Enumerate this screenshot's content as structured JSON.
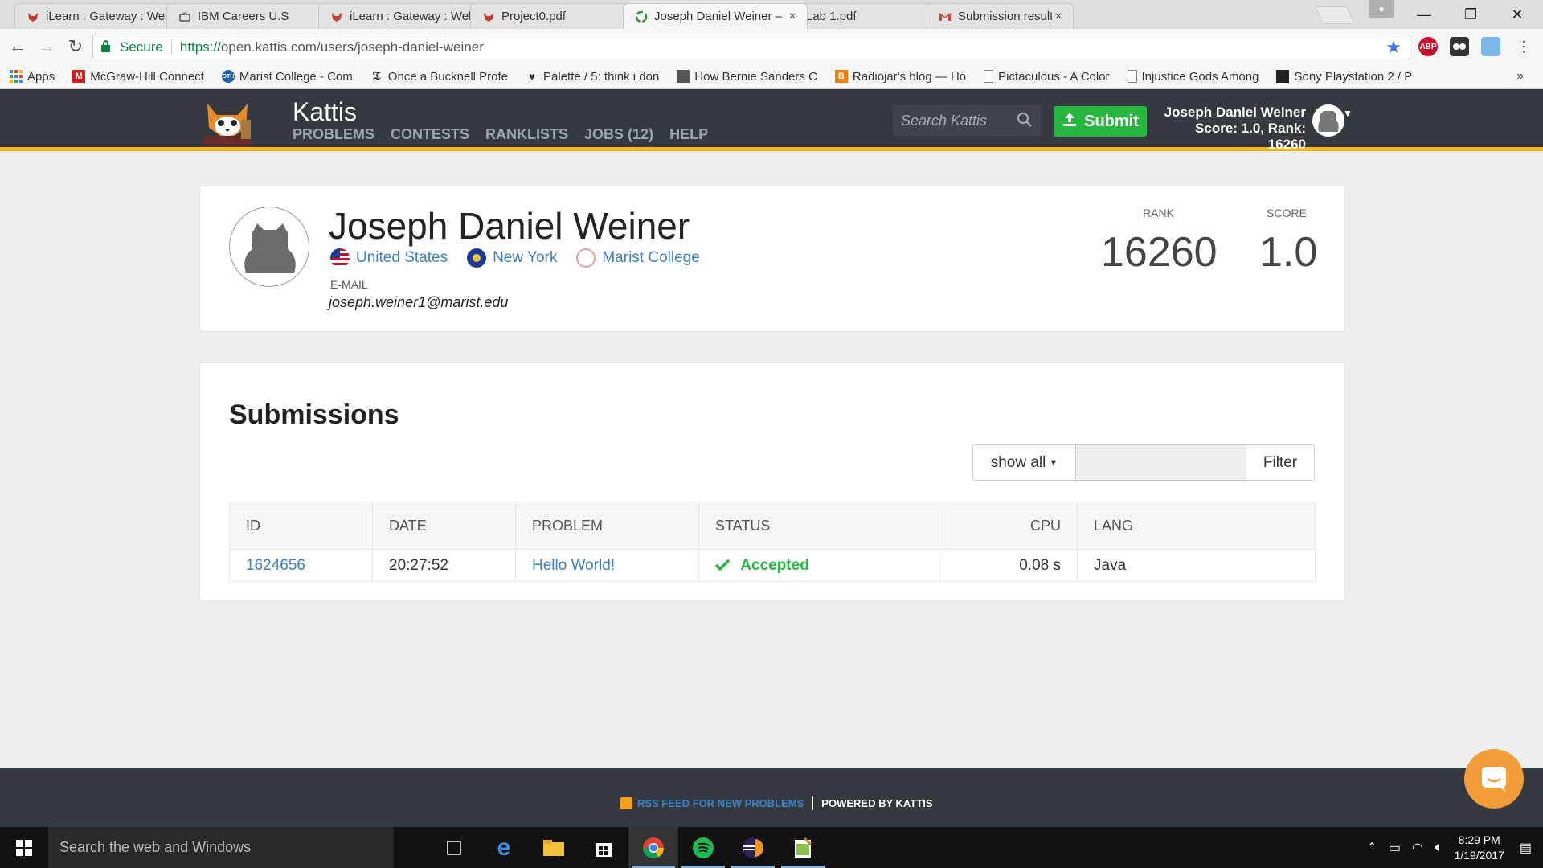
{
  "browser": {
    "tabs": [
      {
        "title": "iLearn : Gateway : Welc",
        "favicon": "fox-icon",
        "active": false
      },
      {
        "title": "IBM Careers U.S",
        "favicon": "briefcase-icon",
        "active": false
      },
      {
        "title": "iLearn : Gateway : Welc",
        "favicon": "fox-icon",
        "active": false
      },
      {
        "title": "Project0.pdf",
        "favicon": "fox-icon",
        "active": false
      },
      {
        "title": "Joseph Daniel Weiner –",
        "favicon": "kattis-icon",
        "active": true
      },
      {
        "title": "Lab 1.pdf",
        "favicon": "fox-icon",
        "active": false
      },
      {
        "title": "Submission result for: jo",
        "favicon": "gmail-icon",
        "active": false
      }
    ],
    "tab_close_glyph": "×",
    "window_controls": {
      "minimize": "—",
      "restore": "❐",
      "close": "✕"
    },
    "address": {
      "secure_label": "Secure",
      "url_scheme": "https://",
      "url_rest": "open.kattis.com/users/joseph-daniel-weiner"
    },
    "extensions": [
      {
        "name": "adblock-plus-icon",
        "label": "ABP",
        "color": "#c70d2c"
      },
      {
        "name": "ghostery-icon",
        "label": "",
        "color": "#333333"
      },
      {
        "name": "extension-icon",
        "label": "",
        "color": "#7ab6e8"
      }
    ],
    "bookmarks": [
      {
        "label": "Apps",
        "icon": "apps-grid-icon"
      },
      {
        "label": "McGraw-Hill Connect",
        "icon": "mcgraw-hill-icon"
      },
      {
        "label": "Marist College - Com",
        "icon": "marist-icon"
      },
      {
        "label": "Once a Bucknell Profe",
        "icon": "nyt-icon"
      },
      {
        "label": "Palette / 5: think i don",
        "icon": "heart-icon"
      },
      {
        "label": "How Bernie Sanders C",
        "icon": "image-icon"
      },
      {
        "label": "Radiojar's blog — Ho",
        "icon": "blogger-icon"
      },
      {
        "label": "Pictaculous - A Color",
        "icon": "page-icon"
      },
      {
        "label": "Injustice Gods Among",
        "icon": "page-icon"
      },
      {
        "label": "Sony Playstation 2 / P",
        "icon": "image-icon"
      }
    ],
    "bookmarks_more": "»"
  },
  "kattis": {
    "brand": "Kattis",
    "nav": [
      "PROBLEMS",
      "CONTESTS",
      "RANKLISTS",
      "JOBS (12)",
      "HELP"
    ],
    "search_placeholder": "Search Kattis",
    "submit_label": "Submit",
    "user_name": "Joseph Daniel Weiner",
    "user_stats": "Score: 1.0, Rank: 16260",
    "colors": {
      "accent": "#f6b21a",
      "header": "#343a40",
      "green": "#27b63f",
      "link": "#3d7fc1"
    }
  },
  "profile": {
    "name": "Joseph Daniel Weiner",
    "locations": [
      {
        "label": "United States",
        "icon": "us-flag-icon"
      },
      {
        "label": "New York",
        "icon": "new-york-flag-icon"
      },
      {
        "label": "Marist College",
        "icon": "marist-seal-icon"
      }
    ],
    "email_label": "E-MAIL",
    "email": "joseph.weiner1@marist.edu",
    "rank_label": "RANK",
    "rank": "16260",
    "score_label": "SCORE",
    "score": "1.0"
  },
  "submissions": {
    "title": "Submissions",
    "filter_select": "show all",
    "filter_input_value": "",
    "filter_button": "Filter",
    "columns": [
      "ID",
      "DATE",
      "PROBLEM",
      "STATUS",
      "CPU",
      "LANG"
    ],
    "rows": [
      {
        "id": "1624656",
        "date": "20:27:52",
        "problem": "Hello World!",
        "status": "Accepted",
        "cpu": "0.08 s",
        "lang": "Java"
      }
    ]
  },
  "footer": {
    "rss_link": "RSS FEED FOR NEW PROBLEMS",
    "powered": "POWERED BY KATTIS"
  },
  "taskbar": {
    "search_placeholder": "Search the web and Windows",
    "apps": [
      "task-view-icon",
      "edge-icon",
      "file-explorer-icon",
      "store-icon",
      "chrome-icon",
      "spotify-icon",
      "eclipse-icon",
      "notepad-icon"
    ],
    "time": "8:29 PM",
    "date": "1/19/2017"
  }
}
